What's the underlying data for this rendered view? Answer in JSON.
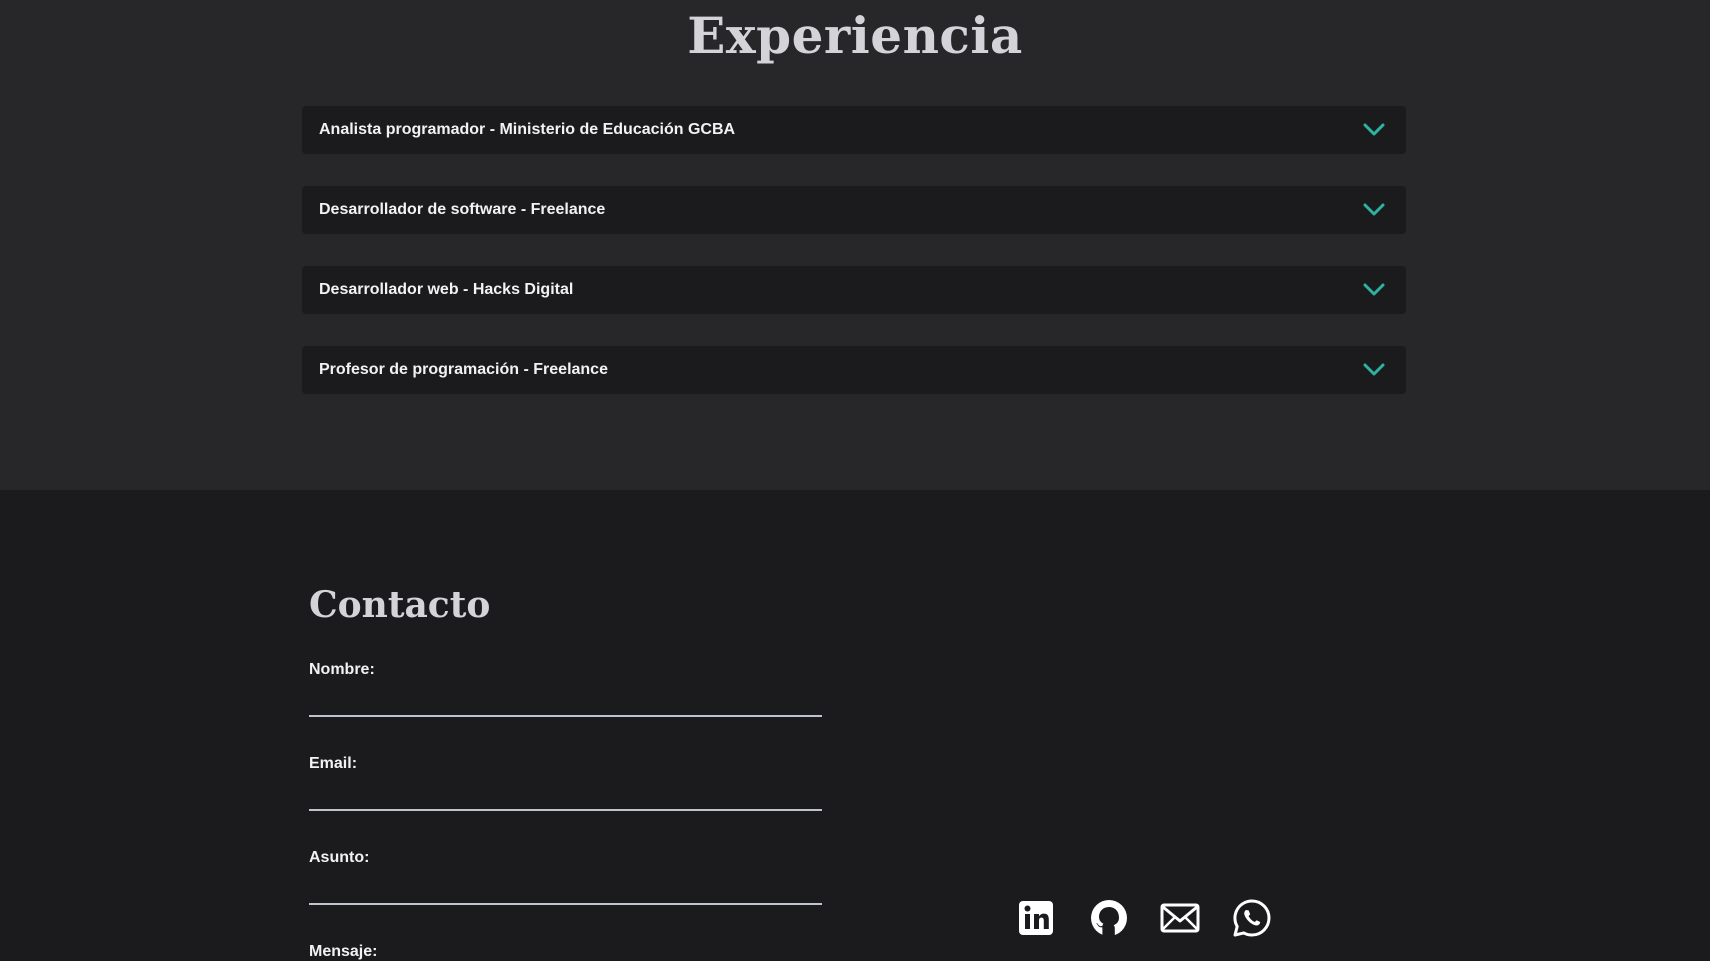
{
  "experience": {
    "title": "Experiencia",
    "items": [
      {
        "label": "Analista programador - Ministerio de Educación GCBA"
      },
      {
        "label": "Desarrollador de software - Freelance"
      },
      {
        "label": "Desarrollador web - Hacks Digital"
      },
      {
        "label": "Profesor de programación - Freelance"
      }
    ],
    "chevron_icon": "chevron-down-icon"
  },
  "contact": {
    "title": "Contacto",
    "fields": {
      "name_label": "Nombre:",
      "name_value": "",
      "email_label": "Email:",
      "email_value": "",
      "subject_label": "Asunto:",
      "subject_value": "",
      "message_label": "Mensaje:"
    },
    "social_icons": [
      "linkedin-icon",
      "github-icon",
      "mail-icon",
      "whatsapp-icon"
    ]
  },
  "colors": {
    "accent": "#2bb5a0",
    "section_bg": "#27272a",
    "card_bg": "#1b1b1e",
    "heading": "#d4d4d8"
  }
}
